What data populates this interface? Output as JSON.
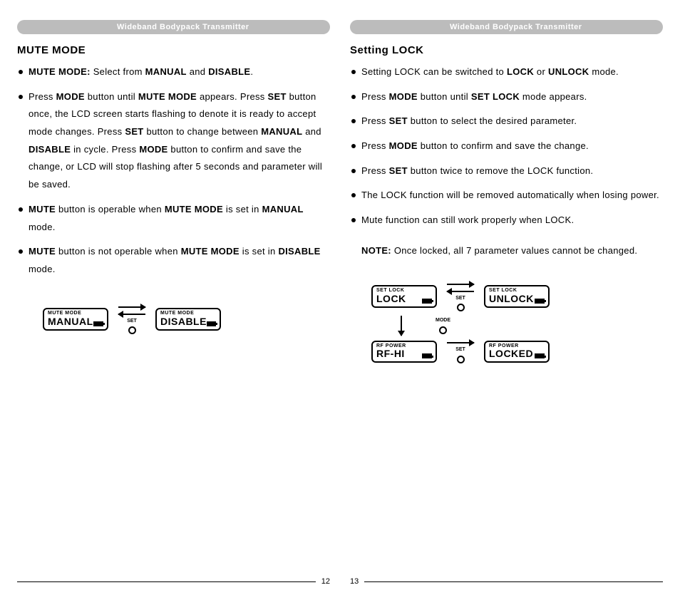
{
  "header_text": "Wideband Bodypack Transmitter",
  "left": {
    "section_title": "MUTE MODE",
    "bullets": [
      {
        "parts": [
          {
            "t": "MUTE MODE:",
            "b": true
          },
          {
            "t": " Select from ",
            "b": false
          },
          {
            "t": "MANUAL",
            "b": true
          },
          {
            "t": " and ",
            "b": false
          },
          {
            "t": "DISABLE",
            "b": true
          },
          {
            "t": ".",
            "b": false
          }
        ]
      },
      {
        "parts": [
          {
            "t": "Press ",
            "b": false
          },
          {
            "t": "MODE",
            "b": true
          },
          {
            "t": " button until ",
            "b": false
          },
          {
            "t": "MUTE MODE",
            "b": true
          },
          {
            "t": " appears. Press ",
            "b": false
          },
          {
            "t": "SET",
            "b": true
          },
          {
            "t": " button once, the LCD screen starts flashing to denote it is ready to accept mode changes. Press ",
            "b": false
          },
          {
            "t": "SET",
            "b": true
          },
          {
            "t": " button to change between ",
            "b": false
          },
          {
            "t": "MANUAL",
            "b": true
          },
          {
            "t": " and ",
            "b": false
          },
          {
            "t": "DISABLE",
            "b": true
          },
          {
            "t": " in cycle. Press ",
            "b": false
          },
          {
            "t": "MODE",
            "b": true
          },
          {
            "t": " button to confirm and save the change, or LCD will stop flashing after 5 seconds and parameter will be saved.",
            "b": false
          }
        ]
      },
      {
        "parts": [
          {
            "t": "MUTE",
            "b": true
          },
          {
            "t": " button is  operable when ",
            "b": false
          },
          {
            "t": "MUTE MODE",
            "b": true
          },
          {
            "t": " is set  in ",
            "b": false
          },
          {
            "t": "MANUAL",
            "b": true
          },
          {
            "t": " mode.",
            "b": false
          }
        ]
      },
      {
        "parts": [
          {
            "t": "MUTE",
            "b": true
          },
          {
            "t": " button is  not operable when ",
            "b": false
          },
          {
            "t": "MUTE MODE",
            "b": true
          },
          {
            "t": " is set in ",
            "b": false
          },
          {
            "t": "DISABLE",
            "b": true
          },
          {
            "t": " mode.",
            "b": false
          }
        ]
      }
    ],
    "diagram": {
      "box1": {
        "small": "MUTE MODE",
        "big": "MANUAL"
      },
      "btn": "SET",
      "box2": {
        "small": "MUTE MODE",
        "big": "DISABLE"
      }
    },
    "page_num": "12"
  },
  "right": {
    "section_title": "Setting LOCK",
    "bullets": [
      {
        "parts": [
          {
            "t": "Setting LOCK can be switched to ",
            "b": false
          },
          {
            "t": "LOCK",
            "b": true
          },
          {
            "t": " or ",
            "b": false
          },
          {
            "t": "UNLOCK",
            "b": true
          },
          {
            "t": " mode.",
            "b": false
          }
        ]
      },
      {
        "parts": [
          {
            "t": "Press ",
            "b": false
          },
          {
            "t": "MODE",
            "b": true
          },
          {
            "t": " button until ",
            "b": false
          },
          {
            "t": "SET LOCK",
            "b": true
          },
          {
            "t": " mode appears.",
            "b": false
          }
        ]
      },
      {
        "parts": [
          {
            "t": "Press ",
            "b": false
          },
          {
            "t": "SET",
            "b": true
          },
          {
            "t": " button to select the desired parameter.",
            "b": false
          }
        ]
      },
      {
        "parts": [
          {
            "t": "Press ",
            "b": false
          },
          {
            "t": "MODE",
            "b": true
          },
          {
            "t": " button to confirm and save the change.",
            "b": false
          }
        ]
      },
      {
        "parts": [
          {
            "t": "Press ",
            "b": false
          },
          {
            "t": "SET",
            "b": true
          },
          {
            "t": " button twice to remove the LOCK function.",
            "b": false
          }
        ]
      },
      {
        "parts": [
          {
            "t": "The LOCK function will be removed automatically when losing power.",
            "b": false
          }
        ]
      },
      {
        "parts": [
          {
            "t": "Mute function can still work properly when LOCK.",
            "b": false
          }
        ]
      }
    ],
    "note": {
      "label": "NOTE:",
      "text": " Once locked, all 7 parameter values cannot be changed."
    },
    "diagram": {
      "box_lock": {
        "small": "SET  LOCK",
        "big": "LOCK"
      },
      "box_unlock": {
        "small": "SET  LOCK",
        "big": "UNLOCK"
      },
      "box_rfhi": {
        "small": "RF  POWER",
        "big": "RF-HI"
      },
      "box_locked": {
        "small": "RF  POWER",
        "big": "LOCKED"
      },
      "btn_set": "SET",
      "btn_mode": "MODE"
    },
    "page_num": "13"
  }
}
